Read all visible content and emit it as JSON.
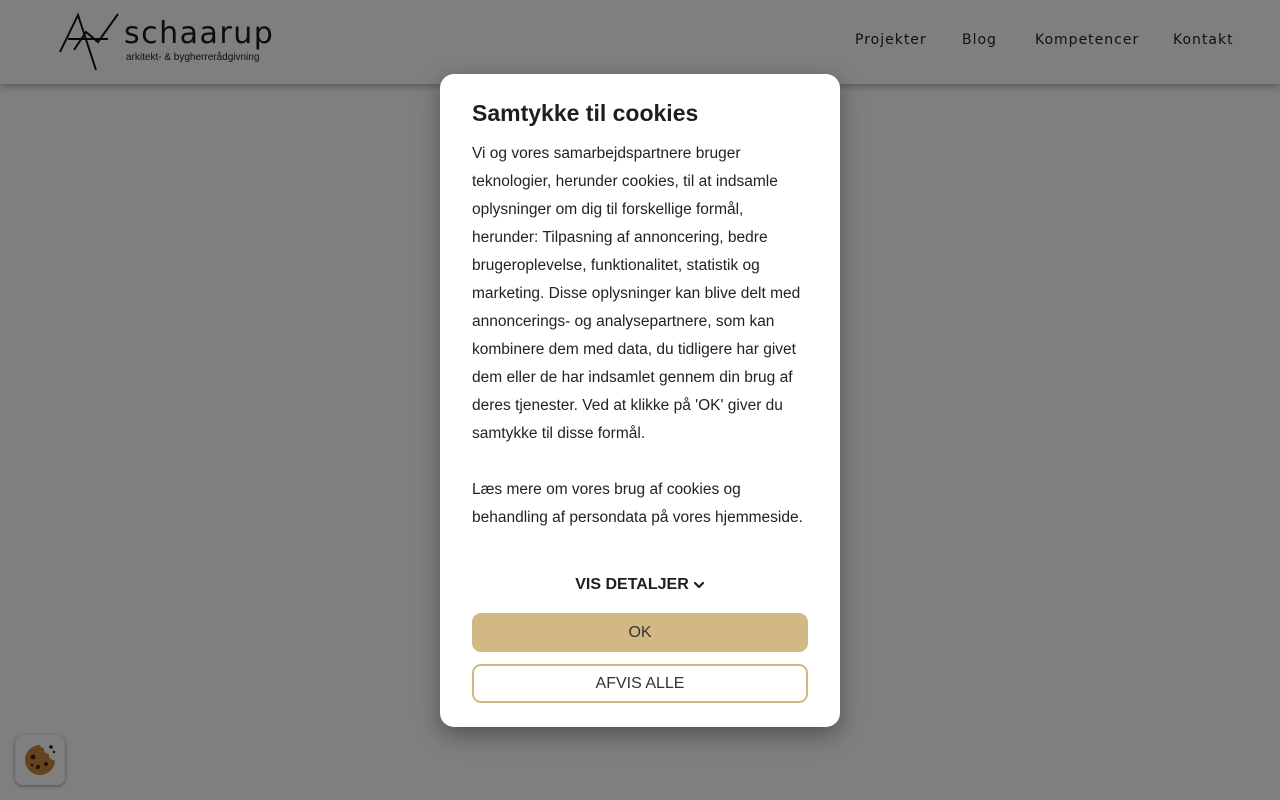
{
  "header": {
    "logo": {
      "wordmark": "schaarup",
      "tagline": "arkitekt- & bygherrerådgivning"
    },
    "nav": [
      {
        "label": "Projekter"
      },
      {
        "label": "Blog"
      },
      {
        "label": "Kompetencer"
      },
      {
        "label": "Kontakt"
      }
    ]
  },
  "cookie_dialog": {
    "title": "Samtykke til cookies",
    "paragraphs": [
      "Vi og vores samarbejdspartnere bruger teknologier, herunder cookies, til at indsamle oplysninger om dig til forskellige formål, herunder: Tilpasning af annoncering, bedre brugeroplevelse, funktionalitet, statistik og marketing. Disse oplysninger kan blive delt med annoncerings- og analysepartnere, som kan kombinere dem med data, du tidligere har givet dem eller de har indsamlet gennem din brug af deres tjenester. Ved at klikke på 'OK' giver du samtykke til disse formål.",
      "Læs mere om vores brug af cookies og behandling af persondata på vores hjemmeside."
    ],
    "details_toggle": "VIS DETALJER",
    "ok_button": "OK",
    "reject_button": "AFVIS ALLE"
  },
  "cookie_settings_button": {
    "icon": "cookie-icon"
  },
  "colors": {
    "accent": "#d2b983",
    "overlay": "rgba(0,0,0,0.5)",
    "text": "#1e1e1e"
  }
}
